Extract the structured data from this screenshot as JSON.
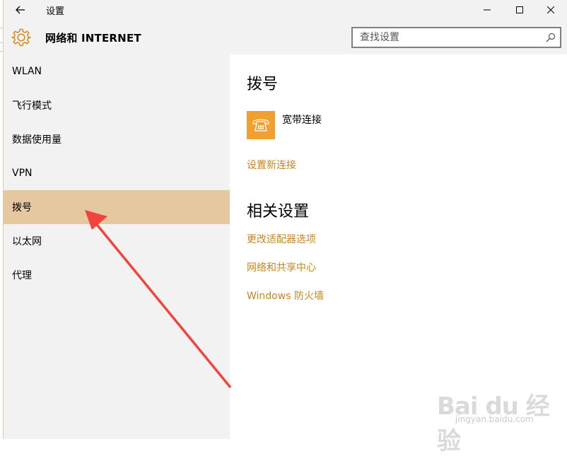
{
  "window": {
    "title": "设置"
  },
  "header": {
    "title": "网络和 INTERNET",
    "search": {
      "placeholder": "查找设置",
      "value": ""
    }
  },
  "sidebar": {
    "items": [
      {
        "label": "WLAN"
      },
      {
        "label": "飞行模式"
      },
      {
        "label": "数据使用量"
      },
      {
        "label": "VPN"
      },
      {
        "label": "拨号",
        "selected": true
      },
      {
        "label": "以太网"
      },
      {
        "label": "代理"
      }
    ]
  },
  "main": {
    "dialup_title": "拨号",
    "connection": {
      "name": "宽带连接",
      "icon": "phone-icon"
    },
    "new_connection_link": "设置新连接",
    "related_title": "相关设置",
    "related_links": [
      "更改适配器选项",
      "网络和共享中心",
      "Windows 防火墙"
    ]
  },
  "watermark": {
    "main": "Bai du 经验",
    "sub": "jingyan.baidu.com"
  },
  "colors": {
    "accent": "#c9861c",
    "tile": "#f0a030",
    "selected": "#e5c8a0",
    "sidebar_bg": "#f2f2f2",
    "arrow": "#f0443c"
  }
}
